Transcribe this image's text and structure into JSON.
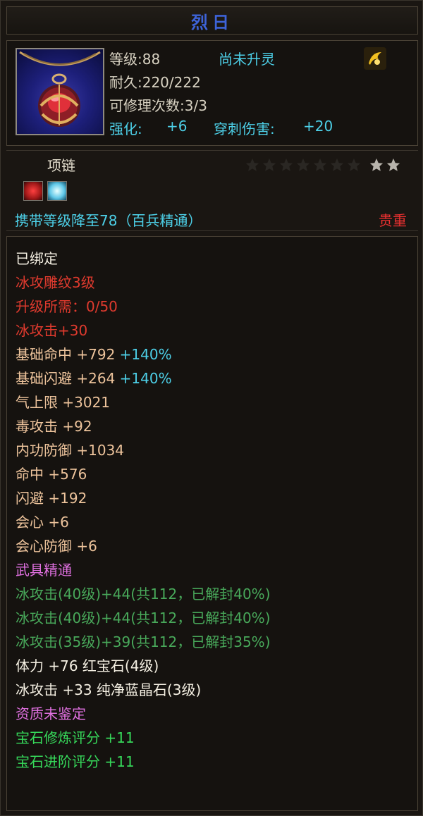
{
  "item": {
    "name": "烈日",
    "level_label": "等级:88",
    "spirit_status": "尚未升灵",
    "durability_label": "耐久:220/222",
    "repair_label": "可修理次数:3/3",
    "enhance_label": "强化:",
    "enhance_value": "+6",
    "pierce_label": "穿刺伤害:",
    "pierce_value": "+20",
    "type": "项链",
    "stars_total": 9,
    "stars_lit": 2,
    "carry_text": "携带等级降至78（百兵精通）",
    "rarity": "贵重"
  },
  "colors": {
    "title": "#3d63d8",
    "cyan": "#4dd0e8",
    "red": "#e03a2e",
    "peach": "#eec49c",
    "pink": "#e070e0",
    "green": "#3ec46a"
  },
  "icons": {
    "item": "red-gem-amulet-icon",
    "rune": "golden-rune-icon",
    "gem1": "red-gem-socket-icon",
    "gem2": "blue-crystal-socket-icon"
  },
  "stats": {
    "bound": "已绑定",
    "engrave": "冰攻雕纹3级",
    "upgrade_req": "升级所需：0/50",
    "ice_attack": "冰攻击+30",
    "base_hit_label": "基础命中 +792",
    "base_hit_pct": "+140%",
    "base_dodge_label": "基础闪避 +264",
    "base_dodge_pct": "+140%",
    "qi": "气上限 +3021",
    "poison": "毒攻击 +92",
    "inner_def": "内功防御 +1034",
    "hit": "命中 +576",
    "dodge": "闪避 +192",
    "crit": "会心 +6",
    "crit_def": "会心防御 +6",
    "weapon_mastery": "武具精通",
    "mastery1": "冰攻击(40级)+44(共112，已解封40%)",
    "mastery2": "冰攻击(40级)+44(共112，已解封40%)",
    "mastery3": "冰攻击(35级)+39(共112，已解封35%)",
    "gem_stat1": "体力 +76 红宝石(4级)",
    "gem_stat2": "冰攻击 +33 纯净蓝晶石(3级)",
    "aptitude": "资质未鉴定",
    "gem_refine": "宝石修炼评分 +11",
    "gem_advance": "宝石进阶评分 +11"
  }
}
